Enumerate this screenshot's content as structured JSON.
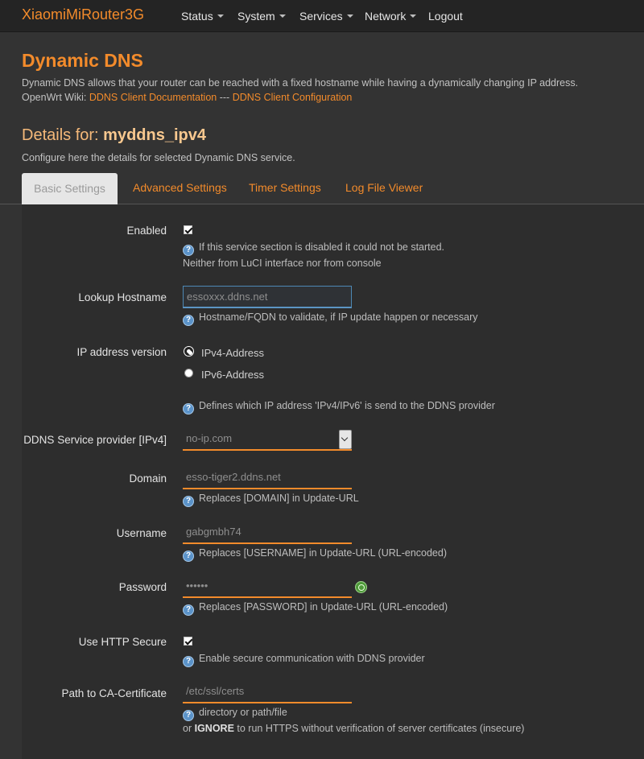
{
  "brand": "XiaomiMiRouter3G",
  "nav": {
    "status": "Status",
    "system": "System",
    "services": "Services",
    "network": "Network",
    "logout": "Logout"
  },
  "page": {
    "title": "Dynamic DNS",
    "description": "Dynamic DNS allows that your router can be reached with a fixed hostname while having a dynamically changing IP address.",
    "wiki_prefix": "OpenWrt Wiki:",
    "wiki_link1": "DDNS Client Documentation",
    "wiki_sep": "---",
    "wiki_link2": "DDNS Client Configuration",
    "details_prefix": "Details for:",
    "details_name": "myddns_ipv4",
    "details_desc": "Configure here the details for selected Dynamic DNS service."
  },
  "tabs": {
    "basic": "Basic Settings",
    "advanced": "Advanced Settings",
    "timer": "Timer Settings",
    "log": "Log File Viewer"
  },
  "form": {
    "enabled": {
      "label": "Enabled",
      "checked": true,
      "help1": "If this service section is disabled it could not be started.",
      "help2": "Neither from LuCI interface nor from console"
    },
    "lookup": {
      "label": "Lookup Hostname",
      "value": "essoxxx.ddns.net",
      "help": "Hostname/FQDN to validate, if IP update happen or necessary"
    },
    "ipver": {
      "label": "IP address version",
      "opt1": "IPv4-Address",
      "opt2": "IPv6-Address",
      "selected": "IPv4-Address",
      "help": "Defines which IP address 'IPv4/IPv6' is send to the DDNS provider"
    },
    "provider": {
      "label": "DDNS Service provider [IPv4]",
      "value": "no-ip.com"
    },
    "domain": {
      "label": "Domain",
      "value": "esso-tiger2.ddns.net",
      "help": "Replaces [DOMAIN] in Update-URL"
    },
    "username": {
      "label": "Username",
      "value": "gabgmbh74",
      "help": "Replaces [USERNAME] in Update-URL (URL-encoded)"
    },
    "password": {
      "label": "Password",
      "value": "••••••",
      "help": "Replaces [PASSWORD] in Update-URL (URL-encoded)"
    },
    "https": {
      "label": "Use HTTP Secure",
      "checked": true,
      "help": "Enable secure communication with DDNS provider"
    },
    "cacert": {
      "label": "Path to CA-Certificate",
      "value": "/etc/ssl/certs",
      "help1": "directory or path/file",
      "help2_prefix": "or",
      "help2_bold": "IGNORE",
      "help2_suffix": "to run HTTPS without verification of server certificates (insecure)"
    }
  },
  "icons": {
    "help": "help-icon",
    "reveal": "reveal-password-icon",
    "caret": "chevron-down-icon"
  },
  "colors": {
    "accent": "#f38b2b",
    "background": "#333333",
    "navbar": "#242424"
  }
}
